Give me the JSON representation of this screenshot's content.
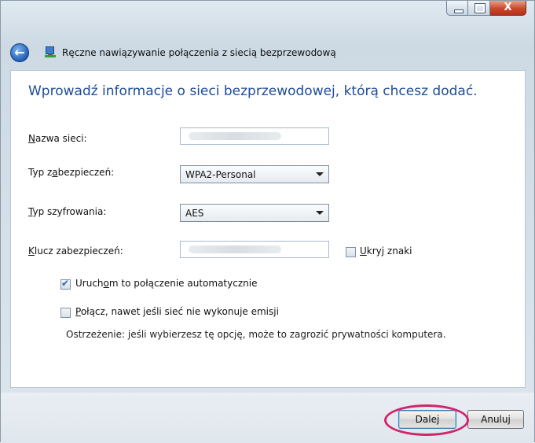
{
  "window": {
    "close_glyph": "X"
  },
  "nav": {
    "title": "Ręczne nawiązywanie połączenia z siecią bezprzewodową"
  },
  "form": {
    "heading": "Wprowadź informacje o sieci bezprzewodowej, którą chcesz dodać.",
    "network_name": {
      "label_pre": "",
      "label_u": "N",
      "label_post": "azwa sieci:",
      "value": ""
    },
    "security_type": {
      "label_pre": "Typ z",
      "label_u": "a",
      "label_post": "bezpieczeń:",
      "value": "WPA2-Personal"
    },
    "encryption_type": {
      "label_pre": "",
      "label_u": "T",
      "label_post": "yp szyfrowania:",
      "value": "AES"
    },
    "security_key": {
      "label_pre": "",
      "label_u": "K",
      "label_post": "lucz zabezpieczeń:",
      "value": ""
    },
    "hide_chars": {
      "label_pre": "",
      "label_u": "U",
      "label_post": "kryj znaki",
      "checked": false
    },
    "auto_connect": {
      "label_pre": "Uruch",
      "label_u": "o",
      "label_post": "m to połączenie automatycznie",
      "checked": true
    },
    "connect_hidden": {
      "label_pre": "",
      "label_u": "P",
      "label_post": "ołącz, nawet jeśli sieć nie wykonuje emisji",
      "checked": false
    },
    "warning": "Ostrzeżenie: jeśli wybierzesz tę opcję, może to zagrozić prywatności komputera."
  },
  "footer": {
    "next_label": "Dalej",
    "cancel_label": "Anuluj"
  },
  "colors": {
    "heading": "#1e4c96",
    "highlight_ring": "#d2246a"
  }
}
